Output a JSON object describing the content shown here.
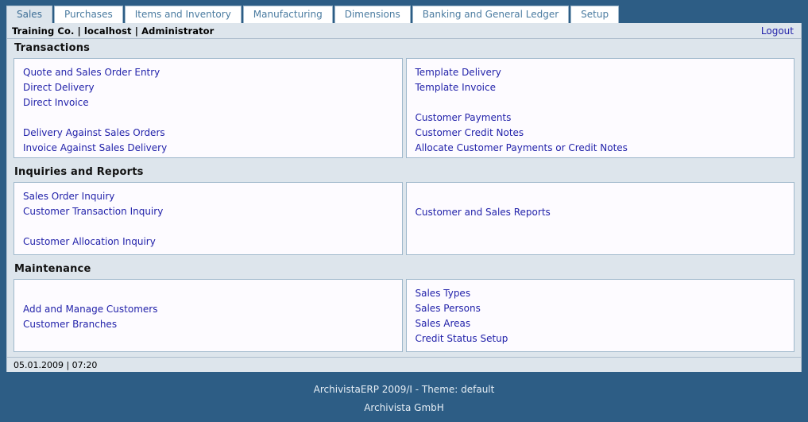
{
  "app": {
    "accent_dark": "#2d5d85",
    "panel_bg": "#dde5ec",
    "link_color": "#2222aa",
    "border_color": "#9fb8cb"
  },
  "tabs": [
    {
      "label": "Sales",
      "active": true
    },
    {
      "label": "Purchases",
      "active": false
    },
    {
      "label": "Items and Inventory",
      "active": false
    },
    {
      "label": "Manufacturing",
      "active": false
    },
    {
      "label": "Dimensions",
      "active": false
    },
    {
      "label": "Banking and General Ledger",
      "active": false
    },
    {
      "label": "Setup",
      "active": false
    }
  ],
  "userbar": {
    "context": "Training Co. | localhost | Administrator",
    "logout_label": "Logout"
  },
  "sections": [
    {
      "title": "Transactions",
      "left_links": [
        "Quote and Sales Order Entry",
        "Direct Delivery",
        "Direct Invoice",
        "",
        "Delivery Against Sales Orders",
        "Invoice Against Sales Delivery"
      ],
      "right_links": [
        "Template Delivery",
        "Template Invoice",
        "",
        "Customer Payments",
        "Customer Credit Notes",
        "Allocate Customer Payments or Credit Notes"
      ]
    },
    {
      "title": "Inquiries and Reports",
      "left_links": [
        "Sales Order Inquiry",
        "Customer Transaction Inquiry",
        "",
        "Customer Allocation Inquiry"
      ],
      "right_links": [
        "",
        "",
        "Customer and Sales Reports"
      ]
    },
    {
      "title": "Maintenance",
      "left_links": [
        "",
        "",
        "Add and Manage Customers",
        "Customer Branches"
      ],
      "right_links": [
        "Sales Types",
        "Sales Persons",
        "Sales Areas",
        "Credit Status Setup"
      ]
    }
  ],
  "statusbar": {
    "datetime": "05.01.2009 | 07:20"
  },
  "footer": {
    "line1": "ArchivistaERP 2009/I - Theme: default",
    "line2": "Archivista GmbH"
  }
}
